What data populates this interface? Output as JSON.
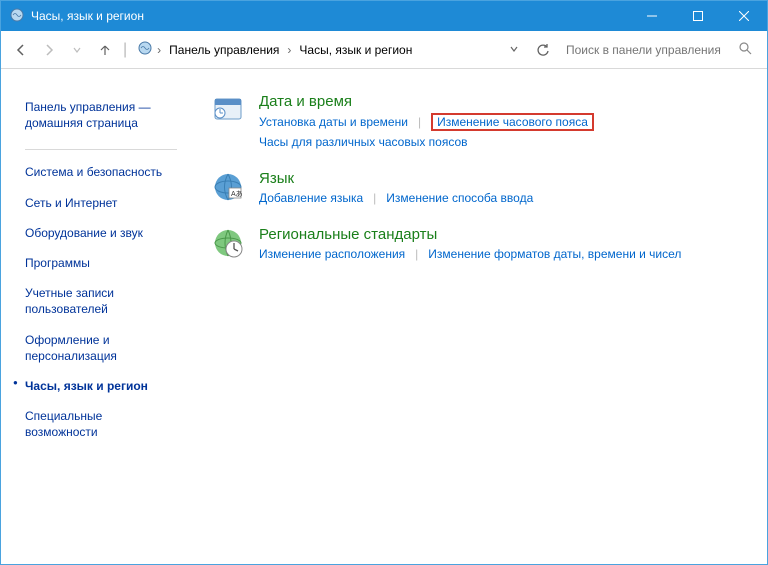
{
  "titlebar": {
    "title": "Часы, язык и регион"
  },
  "nav": {
    "breadcrumb": [
      "Панель управления",
      "Часы, язык и регион"
    ],
    "search_placeholder": "Поиск в панели управления"
  },
  "sidebar": {
    "home": "Панель управления — домашняя страница",
    "items": [
      "Система и безопасность",
      "Сеть и Интернет",
      "Оборудование и звук",
      "Программы",
      "Учетные записи пользователей",
      "Оформление и персонализация",
      "Часы, язык и регион",
      "Специальные возможности"
    ],
    "active_index": 6
  },
  "main": {
    "categories": [
      {
        "title": "Дата и время",
        "rows": [
          [
            {
              "text": "Установка даты и времени",
              "highlight": false
            },
            {
              "text": "Изменение часового пояса",
              "highlight": true
            }
          ],
          [
            {
              "text": "Часы для различных часовых поясов",
              "highlight": false
            }
          ]
        ]
      },
      {
        "title": "Язык",
        "rows": [
          [
            {
              "text": "Добавление языка",
              "highlight": false
            },
            {
              "text": "Изменение способа ввода",
              "highlight": false
            }
          ]
        ]
      },
      {
        "title": "Региональные стандарты",
        "rows": [
          [
            {
              "text": "Изменение расположения",
              "highlight": false
            },
            {
              "text": "Изменение форматов даты, времени и чисел",
              "highlight": false
            }
          ]
        ]
      }
    ]
  }
}
